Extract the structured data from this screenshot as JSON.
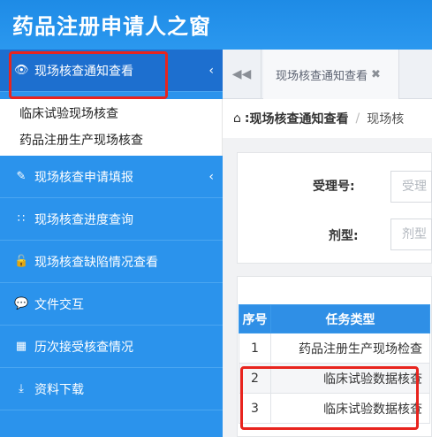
{
  "app": {
    "title": "药品注册申请人之窗"
  },
  "sidebar": {
    "items": [
      {
        "icon": "eye-icon",
        "label": "现场核查通知查看",
        "expanded": true
      },
      {
        "icon": "edit-icon",
        "label": "现场核查申请填报",
        "expanded": false
      },
      {
        "icon": "spinner-icon",
        "label": "现场核查进度查询"
      },
      {
        "icon": "unlock-icon",
        "label": "现场核查缺陷情况查看"
      },
      {
        "icon": "comments-icon",
        "label": "文件交互"
      },
      {
        "icon": "table-icon",
        "label": "历次接受核查情况"
      },
      {
        "icon": "download-icon",
        "label": "资料下载"
      }
    ],
    "submenu": [
      {
        "label": "临床试验现场核查"
      },
      {
        "label": "药品注册生产现场核查"
      }
    ]
  },
  "tabs": {
    "items": [
      {
        "label": "现场核查通知查看",
        "closable": true
      }
    ]
  },
  "breadcrumb": {
    "current": "现场核查通知查看",
    "crumb": "现场核"
  },
  "form": {
    "acceptance_label": "受理号:",
    "acceptance_placeholder": "受理",
    "dosage_label": "剂型:",
    "dosage_placeholder": "剂型"
  },
  "table": {
    "headers": [
      "序号",
      "任务类型"
    ],
    "rows": [
      {
        "no": "1",
        "type": "药品注册生产现场检查"
      },
      {
        "no": "2",
        "type": "临床试验数据核查"
      },
      {
        "no": "3",
        "type": "临床试验数据核查"
      }
    ]
  },
  "colors": {
    "header": "#1e8be6",
    "sidebar": "#2b93ec",
    "active": "#1d6fcf",
    "highlight": "#e8241e",
    "table_header": "#2f8fe6"
  }
}
